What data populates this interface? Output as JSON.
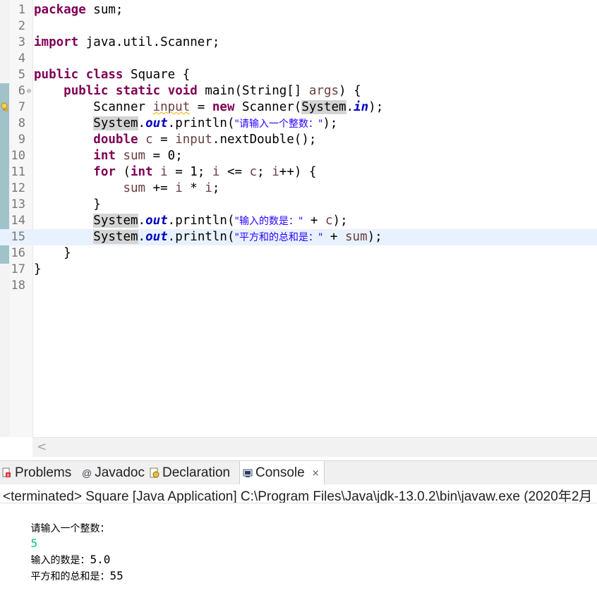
{
  "editor": {
    "lines": [
      {
        "n": "1",
        "tokens": [
          {
            "t": "package",
            "c": "kw"
          },
          {
            "t": " sum;"
          }
        ]
      },
      {
        "n": "2",
        "tokens": []
      },
      {
        "n": "3",
        "tokens": [
          {
            "t": "import",
            "c": "kw"
          },
          {
            "t": " java.util.Scanner;"
          }
        ]
      },
      {
        "n": "4",
        "tokens": []
      },
      {
        "n": "5",
        "tokens": [
          {
            "t": "public",
            "c": "kw"
          },
          {
            "t": " "
          },
          {
            "t": "class",
            "c": "kw"
          },
          {
            "t": " Square {"
          }
        ]
      },
      {
        "n": "6",
        "fold": "⊖",
        "tokens": [
          {
            "t": "    "
          },
          {
            "t": "public",
            "c": "kw"
          },
          {
            "t": " "
          },
          {
            "t": "static",
            "c": "kw"
          },
          {
            "t": " "
          },
          {
            "t": "void",
            "c": "kw"
          },
          {
            "t": " main(String[] "
          },
          {
            "t": "args",
            "c": "var"
          },
          {
            "t": ") {"
          }
        ]
      },
      {
        "n": "7",
        "bulb": true,
        "tokens": [
          {
            "t": "        Scanner "
          },
          {
            "t": "input",
            "c": "var warn"
          },
          {
            "t": " = "
          },
          {
            "t": "new",
            "c": "kw"
          },
          {
            "t": " Scanner("
          },
          {
            "t": "System",
            "c": "hl"
          },
          {
            "t": "."
          },
          {
            "t": "in",
            "c": "fld"
          },
          {
            "t": ");"
          }
        ]
      },
      {
        "n": "8",
        "tokens": [
          {
            "t": "        "
          },
          {
            "t": "System",
            "c": "hl"
          },
          {
            "t": "."
          },
          {
            "t": "out",
            "c": "fld"
          },
          {
            "t": ".println("
          },
          {
            "t": "\"请输入一个整数：\"",
            "c": "str"
          },
          {
            "t": ");"
          }
        ]
      },
      {
        "n": "9",
        "tokens": [
          {
            "t": "        "
          },
          {
            "t": "double",
            "c": "kw"
          },
          {
            "t": " "
          },
          {
            "t": "c",
            "c": "var"
          },
          {
            "t": " = "
          },
          {
            "t": "input",
            "c": "var"
          },
          {
            "t": ".nextDouble();"
          }
        ]
      },
      {
        "n": "10",
        "tokens": [
          {
            "t": "        "
          },
          {
            "t": "int",
            "c": "kw"
          },
          {
            "t": " "
          },
          {
            "t": "sum",
            "c": "var"
          },
          {
            "t": " = 0;"
          }
        ]
      },
      {
        "n": "11",
        "tokens": [
          {
            "t": "        "
          },
          {
            "t": "for",
            "c": "kw"
          },
          {
            "t": " ("
          },
          {
            "t": "int",
            "c": "kw"
          },
          {
            "t": " "
          },
          {
            "t": "i",
            "c": "var"
          },
          {
            "t": " = 1; "
          },
          {
            "t": "i",
            "c": "var"
          },
          {
            "t": " <= "
          },
          {
            "t": "c",
            "c": "var"
          },
          {
            "t": "; "
          },
          {
            "t": "i",
            "c": "var"
          },
          {
            "t": "++) {"
          }
        ]
      },
      {
        "n": "12",
        "tokens": [
          {
            "t": "            "
          },
          {
            "t": "sum",
            "c": "var"
          },
          {
            "t": " += "
          },
          {
            "t": "i",
            "c": "var"
          },
          {
            "t": " * "
          },
          {
            "t": "i",
            "c": "var"
          },
          {
            "t": ";"
          }
        ]
      },
      {
        "n": "13",
        "tokens": [
          {
            "t": "        }"
          }
        ]
      },
      {
        "n": "14",
        "tokens": [
          {
            "t": "        "
          },
          {
            "t": "System",
            "c": "hl"
          },
          {
            "t": "."
          },
          {
            "t": "out",
            "c": "fld"
          },
          {
            "t": ".println("
          },
          {
            "t": "\"输入的数是：\"",
            "c": "str"
          },
          {
            "t": " + "
          },
          {
            "t": "c",
            "c": "var"
          },
          {
            "t": ");"
          }
        ]
      },
      {
        "n": "15",
        "current": true,
        "tokens": [
          {
            "t": "        "
          },
          {
            "t": "System",
            "c": "hl"
          },
          {
            "t": "."
          },
          {
            "t": "out",
            "c": "fld"
          },
          {
            "t": ".println("
          },
          {
            "t": "\"平方和的总和是：\"",
            "c": "str"
          },
          {
            "t": " + "
          },
          {
            "t": "sum",
            "c": "var"
          },
          {
            "t": ");"
          }
        ]
      },
      {
        "n": "16",
        "tokens": [
          {
            "t": "    }"
          }
        ]
      },
      {
        "n": "17",
        "tokens": [
          {
            "t": "}"
          }
        ]
      },
      {
        "n": "18",
        "tokens": []
      }
    ]
  },
  "tabs": {
    "problems": "Problems",
    "javadoc": "Javadoc",
    "declaration": "Declaration",
    "console": "Console"
  },
  "console": {
    "status": "<terminated> Square [Java Application] C:\\Program Files\\Java\\jdk-13.0.2\\bin\\javaw.exe (2020年2月",
    "prompt": "请输入一个整数：",
    "user_input": "5",
    "out1_label": "输入的数是：",
    "out1_value": "5.0",
    "out2_label": "平方和的总和是：",
    "out2_value": "55"
  },
  "colors": {
    "keyword": "#7f0055",
    "string": "#2a00ff",
    "field": "#0000c0",
    "variable": "#6a3e3e",
    "console_input": "#00c87d",
    "current_line": "#e8f2fe"
  }
}
